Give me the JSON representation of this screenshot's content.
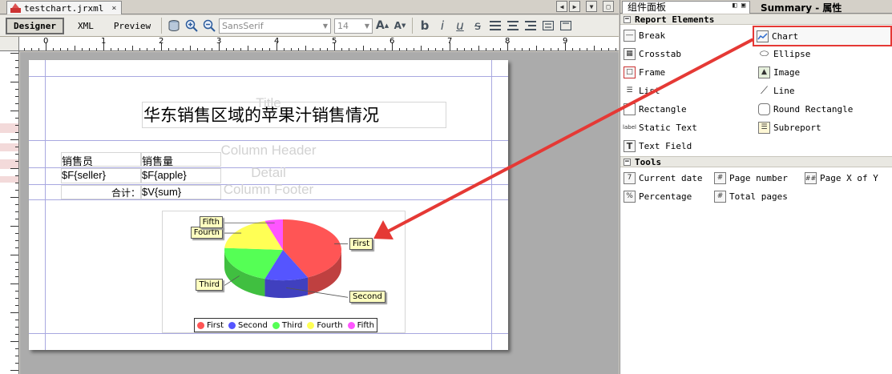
{
  "tab": {
    "file_name": "testchart.jrxml",
    "close": "×"
  },
  "toolbar": {
    "designer_label": "Designer",
    "xml_label": "XML",
    "preview_label": "Preview",
    "font_family": "SansSerif",
    "font_size": "14"
  },
  "ruler": {
    "marks": [
      "0",
      "1",
      "2",
      "3",
      "4",
      "5",
      "6",
      "7",
      "8",
      "9"
    ]
  },
  "report": {
    "title": "华东销售区域的苹果汁销售情况",
    "band_title": "Title",
    "band_column_header": "Column Header",
    "band_detail": "Detail",
    "band_column_footer": "Column Footer",
    "header_seller": "销售员",
    "header_sales": "销售量",
    "field_seller": "$F{seller}",
    "field_apple": "$F{apple}",
    "total_label": "合计：",
    "variable_sum": "$V{sum}"
  },
  "chart_data": {
    "type": "pie",
    "title": "",
    "categories": [
      "First",
      "Second",
      "Third",
      "Fourth",
      "Fifth"
    ],
    "values": [
      43,
      12,
      21,
      19,
      5
    ],
    "colors": [
      "#ff5555",
      "#5555ff",
      "#55ff55",
      "#ffff55",
      "#ff55ff"
    ],
    "legend_position": "bottom"
  },
  "palette": {
    "tab_title": "组件面板",
    "summary_tab": "Summary - 属性",
    "report_elements_title": "Report Elements",
    "tools_title": "Tools",
    "items": {
      "break": "Break",
      "chart": "Chart",
      "crosstab": "Crosstab",
      "ellipse": "Ellipse",
      "frame": "Frame",
      "image": "Image",
      "list": "List",
      "line": "Line",
      "rectangle": "Rectangle",
      "round_rectangle": "Round Rectangle",
      "static_text": "Static Text",
      "subreport": "Subreport",
      "text_field": "Text Field"
    },
    "tools": {
      "current_date": "Current date",
      "page_number": "Page number",
      "page_x_of_y": "Page X of Y",
      "percentage": "Percentage",
      "total_pages": "Total pages"
    }
  },
  "annotation": {
    "color": "#e53935"
  }
}
